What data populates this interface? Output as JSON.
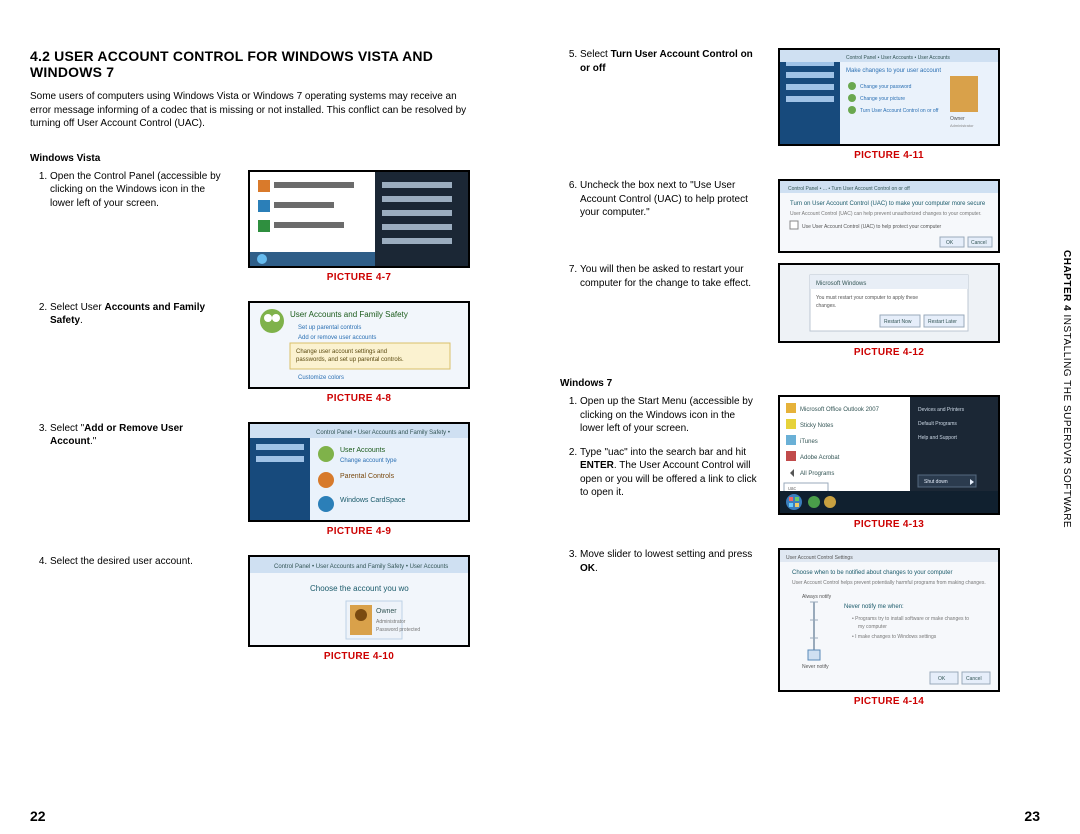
{
  "header": {
    "section_title": "4.2 USER ACCOUNT CONTROL FOR WINDOWS VISTA AND WINDOWS 7"
  },
  "intro": "Some users of computers using Windows Vista or Windows 7 operating systems may receive an error message informing of a codec that is missing or not installed. This conflict can be resolved by turning off User Account Control (UAC).",
  "vista": {
    "heading": "Windows Vista",
    "step1": "Open the Control Panel (accessible by clicking on the Windows icon in the lower left of your screen.",
    "step2_pre": "Select User ",
    "step2_bold": "Accounts and Family Safety",
    "step2_post": ".",
    "step3_pre": "Select \"",
    "step3_bold": "Add or Remove User Account",
    "step3_post": ".\"",
    "step4": "Select the desired user account.",
    "step5_pre": "Select ",
    "step5_bold": "Turn User Account Control on or off",
    "step6": "Uncheck the box next to \"Use User Account Control (UAC) to help protect your computer.\"",
    "step7": "You will then be asked to restart your computer for the change to take effect."
  },
  "win7": {
    "heading": "Windows 7",
    "step1": "Open up the Start Menu (accessible by clicking on the Windows icon in the lower left of your screen.",
    "step2_pre": "Type \"uac\" into the search bar and hit ",
    "step2_bold": "ENTER",
    "step2_post": ". The User Account Control will open or you will be offered a link to click to open it.",
    "step3_pre": "Move slider to lowest setting and press ",
    "step3_bold": "OK",
    "step3_post": "."
  },
  "captions": {
    "p47": "PICTURE 4-7",
    "p48": "PICTURE 4-8",
    "p49": "PICTURE 4-9",
    "p410": "PICTURE 4-10",
    "p411": "PICTURE 4-11",
    "p412": "PICTURE 4-12",
    "p413": "PICTURE 4-13",
    "p414": "PICTURE 4-14"
  },
  "sidetab": {
    "chapter": "CHAPTER 4",
    "title": " INSTALLING THE SUPERDVR SOFTWARE"
  },
  "pagenums": {
    "left": "22",
    "right": "23"
  }
}
